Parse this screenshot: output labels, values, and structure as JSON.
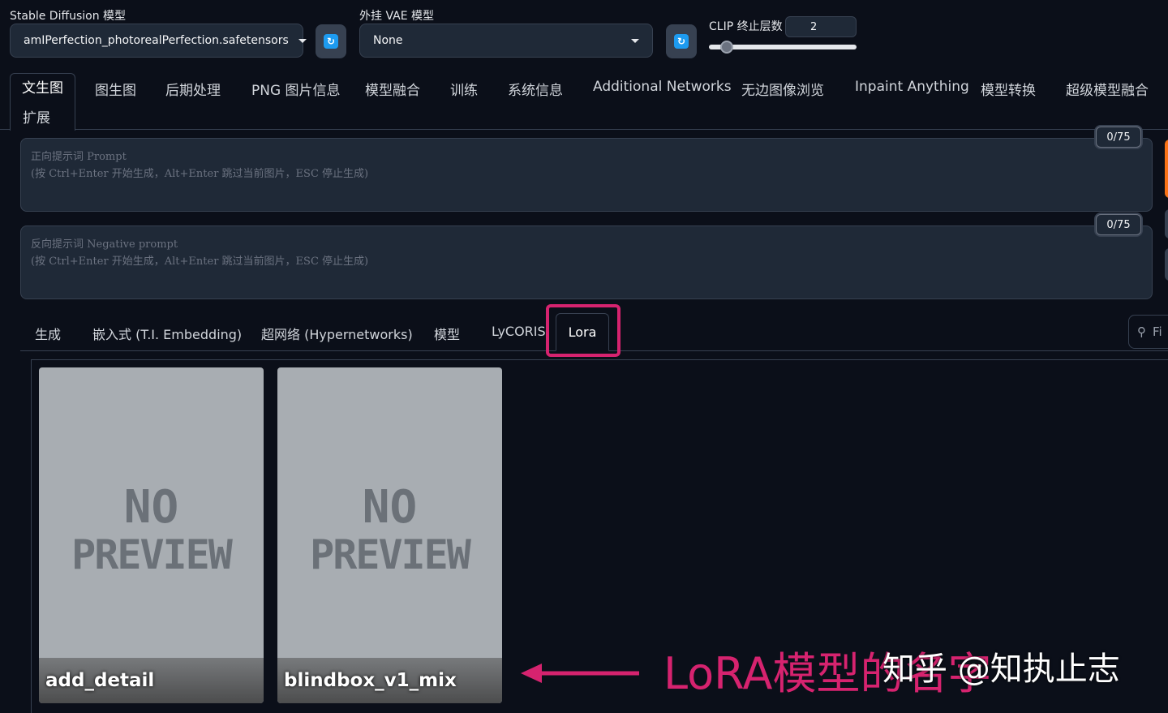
{
  "header": {
    "sd_model_label": "Stable Diffusion 模型",
    "sd_model_value": "amIPerfection_photorealPerfection.safetensors",
    "vae_label": "外挂 VAE 模型",
    "vae_value": "None",
    "clip_label": "CLIP 终止层数",
    "clip_value": "2",
    "clip_slider_fraction": 0.12
  },
  "main_tabs": [
    "文生图",
    "图生图",
    "后期处理",
    "PNG 图片信息",
    "模型融合",
    "训练",
    "系统信息",
    "Additional Networks",
    "无边图像浏览",
    "Inpaint Anything",
    "模型转换",
    "超级模型融合",
    "扩展"
  ],
  "prompt": {
    "positive_placeholder_1": "正向提示词 Prompt",
    "positive_placeholder_2": "(按 Ctrl+Enter 开始生成，Alt+Enter 跳过当前图片，ESC 停止生成)",
    "positive_counter": "0/75",
    "negative_placeholder_1": "反向提示词 Negative prompt",
    "negative_placeholder_2": "(按 Ctrl+Enter 开始生成，Alt+Enter 跳过当前图片，ESC 停止生成)",
    "negative_counter": "0/75"
  },
  "sub_tabs": [
    "生成",
    "嵌入式 (T.I. Embedding)",
    "超网络 (Hypernetworks)",
    "模型",
    "LyCORIS",
    "Lora"
  ],
  "search": {
    "placeholder": "Fi"
  },
  "cards": [
    {
      "preview_line1": "NO",
      "preview_line2": "PREVIEW",
      "name": "add_detail"
    },
    {
      "preview_line1": "NO",
      "preview_line2": "PREVIEW",
      "name": "blindbox_v1_mix"
    }
  ],
  "annotation": {
    "text": "LoRA模型的名字",
    "color": "#d6236f"
  },
  "watermark": "知乎 @知执止志",
  "colors": {
    "accent_orange": "#f97316",
    "highlight": "#d6236f",
    "icon_blue": "#1d9bf0"
  }
}
